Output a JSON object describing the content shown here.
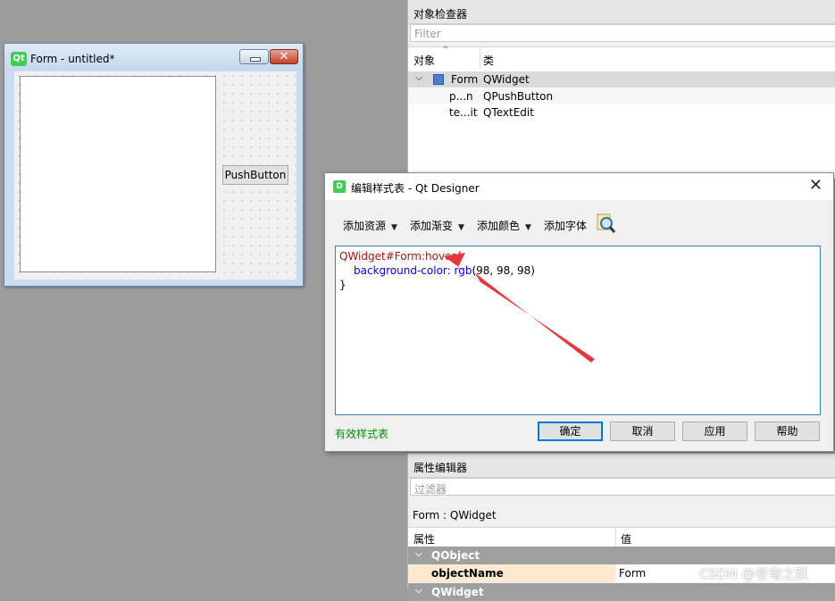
{
  "form_window": {
    "title": "Form - untitled*",
    "qt_logo": "Qt",
    "close_glyph": "✕",
    "push_button_label": "PushButton"
  },
  "object_inspector": {
    "title": "对象检查器",
    "filter_placeholder": "Filter",
    "col_object": "对象",
    "col_class": "类",
    "rows": [
      {
        "object": "Form",
        "class": "QWidget"
      },
      {
        "object": "p...n",
        "class": "QPushButton"
      },
      {
        "object": "te...it",
        "class": "QTextEdit"
      }
    ]
  },
  "dialog": {
    "title": "编辑样式表 - Qt Designer",
    "logo": "D",
    "close_glyph": "✕",
    "toolbar": {
      "add_resource": "添加资源",
      "add_gradient": "添加渐变",
      "add_color": "添加颜色",
      "add_font": "添加字体"
    },
    "code": {
      "line1_selector": "QWidget#Form:hover{",
      "line2_property": "background-color: rgb",
      "line2_value": "(98, 98, 98)",
      "line3": "}"
    },
    "status": "有效样式表",
    "buttons": {
      "ok": "确定",
      "cancel": "取消",
      "apply": "应用",
      "help": "帮助"
    }
  },
  "property_editor": {
    "title": "属性编辑器",
    "filter_placeholder": "过滤器",
    "class_label": "Form : QWidget",
    "col_property": "属性",
    "col_value": "值",
    "group1": "QObject",
    "row_name": "objectName",
    "row_value": "Form",
    "group2": "QWidget"
  },
  "watermark": "CSDN @苍穹之跃",
  "colors": {
    "annotation_arrow": "#e8353a",
    "selector_red": "#a31515",
    "property_blue": "#0000ff",
    "valid_green": "#009100"
  }
}
